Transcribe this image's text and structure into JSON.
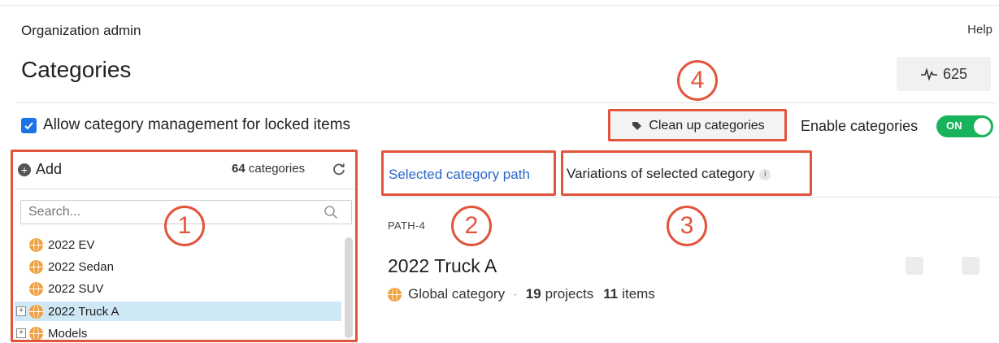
{
  "header": {
    "org_title": "Organization admin",
    "help": "Help",
    "page_title": "Categories",
    "activity_count": "625"
  },
  "options": {
    "allow_locked_label": "Allow category management for locked items",
    "allow_locked_checked": true,
    "cleanup_label": "Clean up categories",
    "enable_label": "Enable categories",
    "enable_state": "ON"
  },
  "sidebar": {
    "add_label": "Add",
    "count_number": "64",
    "count_suffix": "categories",
    "search_placeholder": "Search...",
    "items": [
      {
        "label": "2022 EV",
        "expandable": false,
        "selected": false
      },
      {
        "label": "2022 Sedan",
        "expandable": false,
        "selected": false
      },
      {
        "label": "2022 SUV",
        "expandable": false,
        "selected": false
      },
      {
        "label": "2022 Truck A",
        "expandable": true,
        "selected": true
      },
      {
        "label": "Models",
        "expandable": true,
        "selected": false
      }
    ]
  },
  "tabs": {
    "selected_path": "Selected category path",
    "variations": "Variations of selected category"
  },
  "detail": {
    "path_label": "PATH-4",
    "title": "2022 Truck A",
    "scope": "Global category",
    "projects_count": "19",
    "projects_label": "projects",
    "items_count": "11",
    "items_label": "items"
  },
  "callouts": [
    "1",
    "2",
    "3",
    "4"
  ],
  "colors": {
    "accent_blue": "#2a66c8",
    "callout_red": "#e2553c",
    "toggle_green": "#19b35c",
    "selected_row": "#cfe8f5",
    "globe_orange": "#f2a03d"
  }
}
